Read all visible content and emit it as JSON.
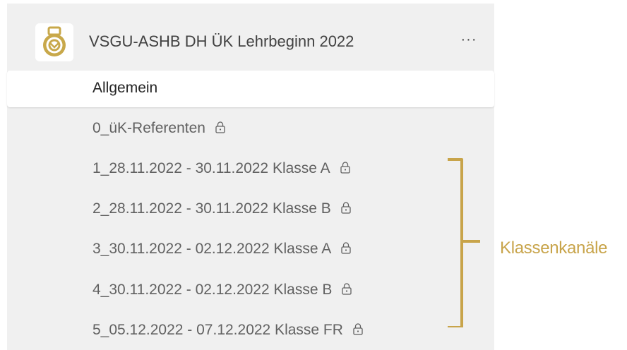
{
  "team": {
    "name": "VSGU-ASHB DH ÜK Lehrbeginn 2022",
    "logo_icon": "gold-ring-logo-icon",
    "more_label": "···"
  },
  "channels": [
    {
      "label": "Allgemein",
      "locked": false,
      "selected": true
    },
    {
      "label": "0_üK-Referenten",
      "locked": true,
      "selected": false
    },
    {
      "label": "1_28.11.2022 - 30.11.2022 Klasse A",
      "locked": true,
      "selected": false
    },
    {
      "label": "2_28.11.2022 - 30.11.2022 Klasse B",
      "locked": true,
      "selected": false
    },
    {
      "label": "3_30.11.2022 - 02.12.2022 Klasse A",
      "locked": true,
      "selected": false
    },
    {
      "label": "4_30.11.2022 - 02.12.2022 Klasse B",
      "locked": true,
      "selected": false
    },
    {
      "label": "5_05.12.2022 - 07.12.2022 Klasse FR",
      "locked": true,
      "selected": false
    }
  ],
  "annotation": {
    "label": "Klassenkanäle",
    "color": "#c8a44a"
  },
  "colors": {
    "panel_bg": "#f0f0f0",
    "selected_bg": "#ffffff",
    "logo_gold": "#c8a84a"
  }
}
